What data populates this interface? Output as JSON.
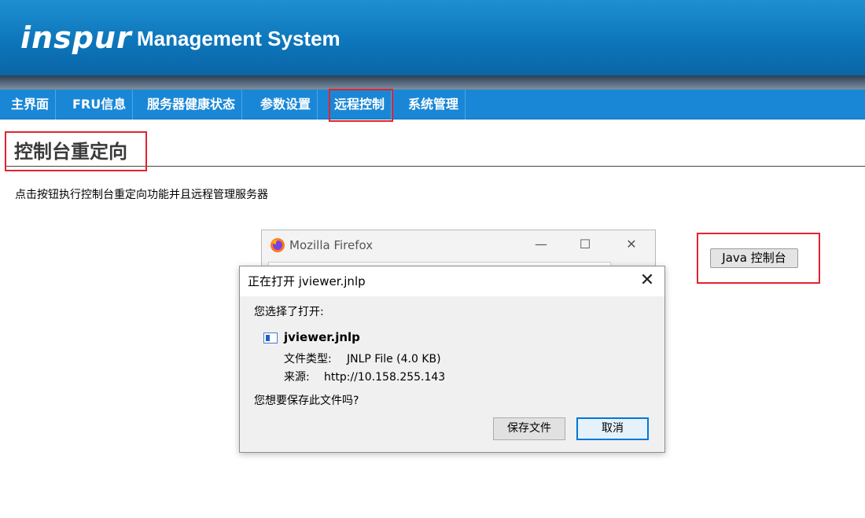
{
  "header": {
    "logo_text": "inspur",
    "system_title": "Management System"
  },
  "nav": {
    "items": [
      {
        "label": "主界面"
      },
      {
        "label": "FRU信息"
      },
      {
        "label": "服务器健康状态"
      },
      {
        "label": "参数设置"
      },
      {
        "label": "远程控制"
      },
      {
        "label": "系统管理"
      }
    ],
    "active": "远程控制"
  },
  "page": {
    "title": "控制台重定向",
    "description": "点击按钮执行控制台重定向功能并且远程管理服务器",
    "java_button_label": "Java 控制台"
  },
  "firefox_window": {
    "title": "Mozilla Firefox",
    "minimize_glyph": "—",
    "maximize_glyph": "☐",
    "close_glyph": "✕"
  },
  "dialog": {
    "title": "正在打开 jviewer.jnlp",
    "close_glyph": "✕",
    "intro": "您选择了打开:",
    "file_name": "jviewer.jnlp",
    "file_type_label": "文件类型:",
    "file_type_value": "JNLP File (4.0 KB)",
    "source_label": "来源:",
    "source_value": "http://10.158.255.143",
    "question": "您想要保存此文件吗?",
    "save_button": "保存文件",
    "cancel_button": "取消"
  },
  "colors": {
    "header_blue": "#0d76bb",
    "nav_blue": "#1a87d6",
    "highlight_red": "#e0242e",
    "focus_blue": "#0078d7"
  }
}
